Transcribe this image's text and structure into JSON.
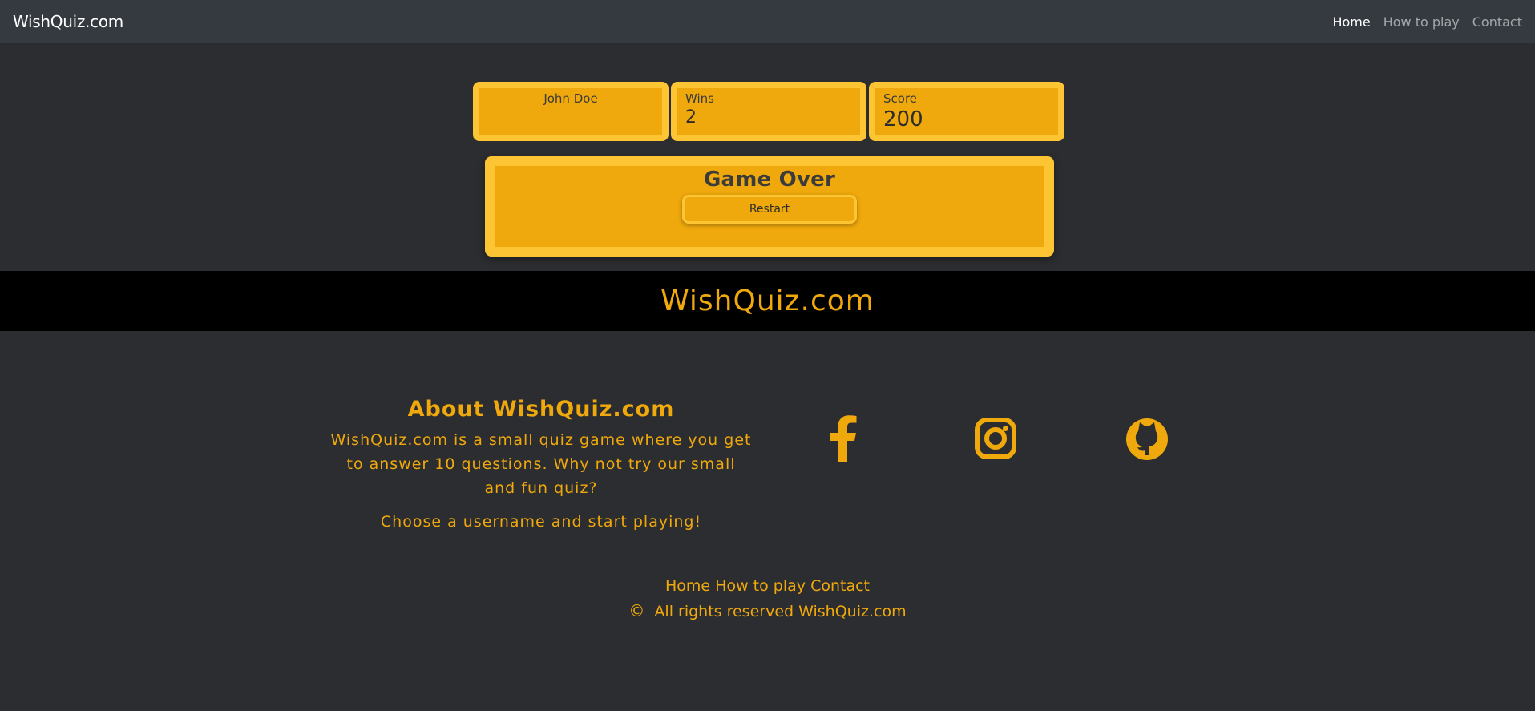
{
  "navbar": {
    "brand": "WishQuiz.com",
    "links": [
      "Home",
      "How to play",
      "Contact"
    ]
  },
  "stats": {
    "player_name": "John Doe",
    "wins_label": "Wins",
    "wins_value": "2",
    "score_label": "Score",
    "score_value": "200"
  },
  "game": {
    "title": "Game Over",
    "restart_label": "Restart"
  },
  "banner": {
    "title": "WishQuiz.com"
  },
  "about": {
    "title": "About WishQuiz.com",
    "text": "WishQuiz.com is a small quiz game where you get to answer 10 questions. Why not try our small and fun quiz?",
    "cta": "Choose a username and start playing!"
  },
  "social": {
    "icons": [
      "facebook-icon",
      "instagram-icon",
      "github-icon"
    ]
  },
  "footer": {
    "links": [
      "Home",
      "How to play",
      "Contact"
    ],
    "copyright_symbol": "©",
    "copyright_text": "All rights reserved WishQuiz.com"
  },
  "colors": {
    "accent": "#f0a90c",
    "card_border": "#fdc434",
    "navbar": "#343a40",
    "background": "#2c2d30",
    "banner": "#000000"
  }
}
